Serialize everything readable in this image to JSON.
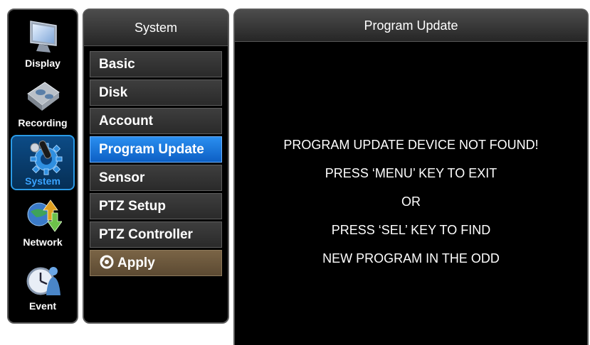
{
  "rail": {
    "items": [
      {
        "label": "Display",
        "icon": "monitor-icon",
        "selected": false
      },
      {
        "label": "Recording",
        "icon": "hard-disk-icon",
        "selected": false
      },
      {
        "label": "System",
        "icon": "gear-icon",
        "selected": true
      },
      {
        "label": "Network",
        "icon": "network-arrows-icon",
        "selected": false
      },
      {
        "label": "Event",
        "icon": "clock-person-icon",
        "selected": false
      }
    ]
  },
  "menu": {
    "title": "System",
    "items": [
      {
        "label": "Basic",
        "selected": false
      },
      {
        "label": "Disk",
        "selected": false
      },
      {
        "label": "Account",
        "selected": false
      },
      {
        "label": "Program Update",
        "selected": true
      },
      {
        "label": "Sensor",
        "selected": false
      },
      {
        "label": "PTZ Setup",
        "selected": false
      },
      {
        "label": "PTZ Controller",
        "selected": false
      }
    ],
    "apply_label": "Apply"
  },
  "main": {
    "title": "Program Update",
    "messages": [
      "PROGRAM UPDATE DEVICE NOT FOUND!",
      "PRESS ‘MENU’ KEY TO EXIT",
      "OR",
      "PRESS ‘SEL’ KEY TO FIND",
      "NEW PROGRAM IN THE ODD"
    ]
  },
  "colors": {
    "selected_menu": "#1a7ae0",
    "selected_rail_border": "#2a9ae6",
    "apply": "#6b5639",
    "panel_bg": "#000000"
  }
}
